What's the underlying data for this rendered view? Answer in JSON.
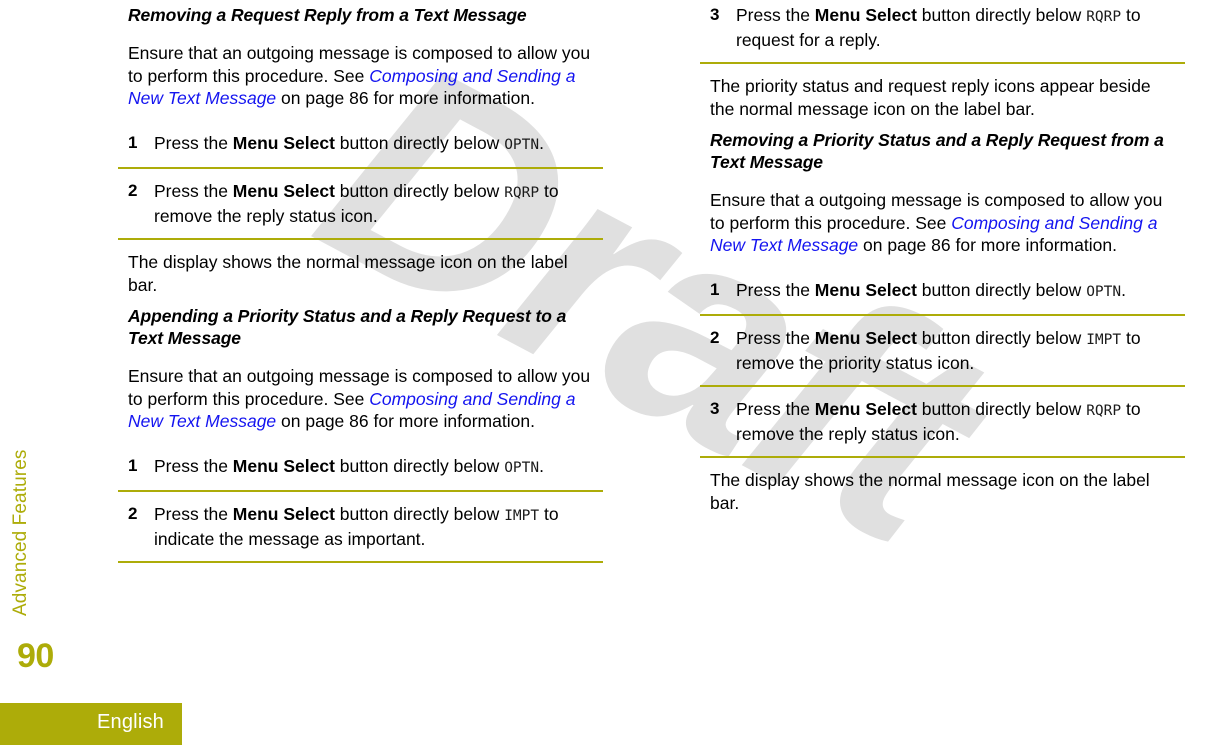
{
  "sidebar": {
    "chapter_label": "Advanced Features",
    "page_number": "90",
    "language_label": "English",
    "accent_color": "#adac09"
  },
  "watermark": {
    "text": "Draft",
    "color": "#e0e0e0"
  },
  "link_color": "#1414f0",
  "left_column": {
    "heading_1": "Removing a Request Reply from a Text Message",
    "intro_1": {
      "part_a": "Ensure that an outgoing message is composed to allow you to perform this procedure. See ",
      "link": "Composing and Sending a New Text Message",
      "part_b": " on page 86 for more information."
    },
    "steps_1": [
      {
        "num": "1",
        "pre": "Press the ",
        "bold": "Menu Select",
        "mid": " button directly below ",
        "lcd": "OPTN",
        "post": "."
      },
      {
        "num": "2",
        "pre": "Press the ",
        "bold": "Menu Select",
        "mid": " button directly below ",
        "lcd": "RQRP",
        "post": " to remove the reply status icon."
      }
    ],
    "result_1": "The display shows the normal message icon on the label bar.",
    "heading_2": "Appending a Priority Status and a Reply Request to a Text Message",
    "intro_2": {
      "part_a": "Ensure that an outgoing message is composed to allow you to perform this procedure. See ",
      "link": "Composing and Sending a New Text Message",
      "part_b": " on page 86 for more information."
    },
    "steps_2": [
      {
        "num": "1",
        "pre": "Press the ",
        "bold": "Menu Select",
        "mid": " button directly below ",
        "lcd": "OPTN",
        "post": "."
      },
      {
        "num": "2",
        "pre": "Press the ",
        "bold": "Menu Select",
        "mid": " button directly below ",
        "lcd": "IMPT",
        "post": " to indicate the message as important."
      }
    ]
  },
  "right_column": {
    "step_3": {
      "num": "3",
      "pre": "Press the ",
      "bold": "Menu Select",
      "mid": " button directly below ",
      "lcd": "RQRP",
      "post": " to request for a reply."
    },
    "result_1": "The priority status and request reply icons appear beside the normal message icon on the label bar.",
    "heading_1": "Removing a Priority Status and a Reply Request from a Text Message",
    "intro_1": {
      "part_a": "Ensure that a outgoing message is composed to allow you to perform this procedure. See ",
      "link": "Composing and Sending a New Text Message",
      "part_b": " on page 86 for more information."
    },
    "steps_1": [
      {
        "num": "1",
        "pre": "Press the ",
        "bold": "Menu Select",
        "mid": " button directly below ",
        "lcd": "OPTN",
        "post": "."
      },
      {
        "num": "2",
        "pre": "Press the ",
        "bold": "Menu Select",
        "mid": " button directly below ",
        "lcd": "IMPT",
        "post": " to remove the priority status icon."
      },
      {
        "num": "3",
        "pre": "Press the ",
        "bold": "Menu Select",
        "mid": " button directly below ",
        "lcd": "RQRP",
        "post": " to remove the reply status icon."
      }
    ],
    "result_2": "The display shows the normal message icon on the label bar."
  }
}
